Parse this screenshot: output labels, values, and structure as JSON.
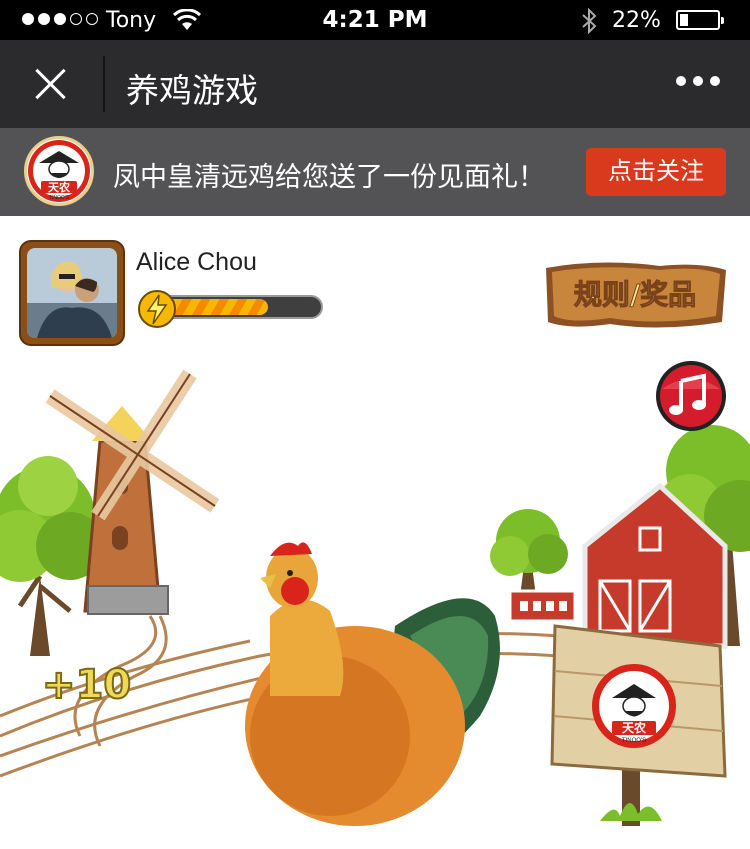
{
  "status_bar": {
    "signal_bars_on": 3,
    "signal_bars_total": 5,
    "carrier": "Tony",
    "wifi_icon": "wifi-icon",
    "time": "4:21 PM",
    "bluetooth_icon": "bluetooth-icon",
    "battery_percent": "22%",
    "battery_level": 0.22
  },
  "nav": {
    "title": "养鸡游戏",
    "close_icon": "close-icon",
    "more_icon": "more-icon"
  },
  "follow_banner": {
    "text": "凤中皇清远鸡给您送了一份见面礼！",
    "button_label": "点击关注",
    "logo_text": "天农",
    "logo_subtext": "TINOO'S",
    "button_color": "#d9391d"
  },
  "player": {
    "name": "Alice Chou",
    "energy_fraction": 0.68
  },
  "game": {
    "rules_button_label": "规则/奖品",
    "music_icon": "music-note-icon",
    "plus_points": "+10",
    "sign_logo_text": "天农",
    "sign_logo_subtext": "TINOO'S"
  }
}
